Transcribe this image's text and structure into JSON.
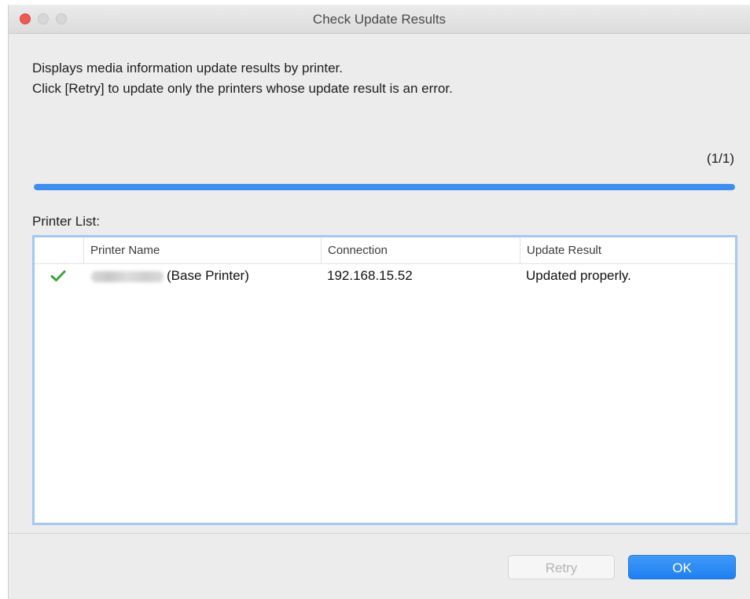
{
  "window": {
    "title": "Check Update Results"
  },
  "description": {
    "line1": "Displays media information update results by printer.",
    "line2": "Click [Retry] to update only the printers whose update result is an error."
  },
  "progress": {
    "counter": "(1/1)",
    "fraction": 1.0
  },
  "printer_list": {
    "label": "Printer List:",
    "columns": [
      "Printer Name",
      "Connection",
      "Update Result"
    ],
    "rows": [
      {
        "status_icon": "check-icon",
        "printer_name_suffix": "(Base Printer)",
        "connection": "192.168.15.52",
        "update_result": "Updated properly."
      }
    ]
  },
  "buttons": {
    "retry": "Retry",
    "ok": "OK"
  },
  "colors": {
    "accent": "#3d8ef0",
    "close": "#ee5a52",
    "check": "#3aa63a"
  }
}
